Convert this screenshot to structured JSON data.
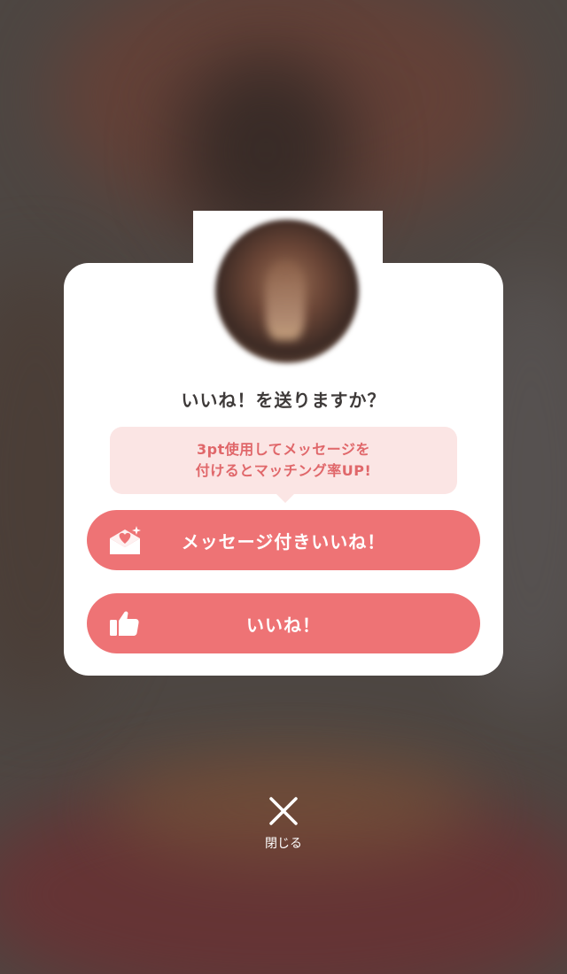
{
  "dialog": {
    "title": "いいね！を送りますか？",
    "tooltip_line1": "3pt使用してメッセージを",
    "tooltip_line2": "付けるとマッチング率UP!",
    "message_like_button": "メッセージ付きいいね！",
    "like_button": "いいね！"
  },
  "close": {
    "label": "閉じる"
  },
  "colors": {
    "accent": "#ee7375",
    "tooltip_bg": "#fbe5e4",
    "tooltip_text": "#e0676a",
    "title_text": "#3e3a39"
  },
  "icons": {
    "message_like": "envelope-heart-icon",
    "like": "thumbs-up-icon",
    "close": "close-icon"
  }
}
